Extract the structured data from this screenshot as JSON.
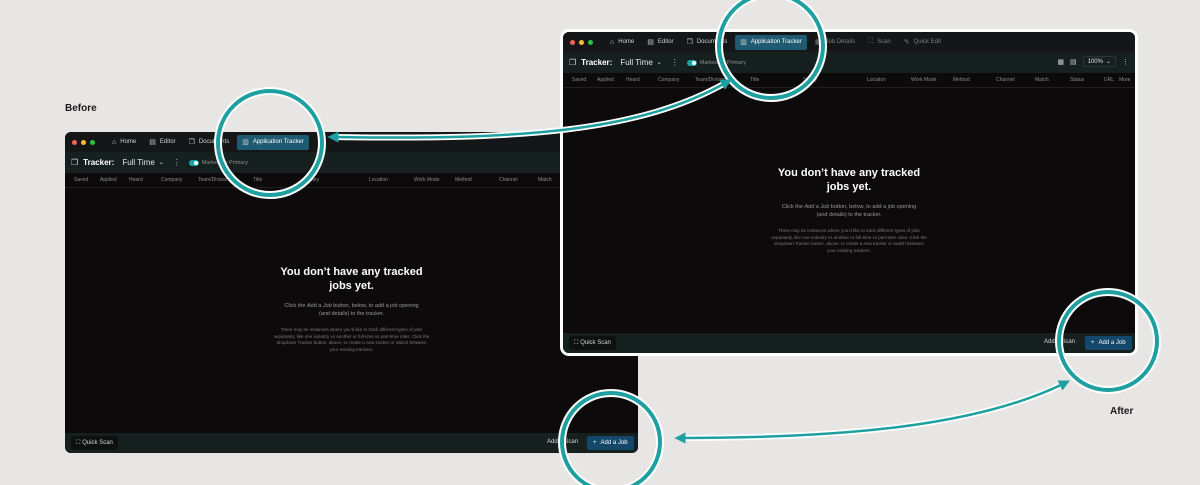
{
  "captions": {
    "before": "Before",
    "after": "After"
  },
  "accent_color": "#1e9fa0",
  "before_window": {
    "tabs": [
      {
        "icon": "home-icon",
        "glyph": "⌂",
        "label": "Home"
      },
      {
        "icon": "editor-icon",
        "glyph": "▤",
        "label": "Editor"
      },
      {
        "icon": "documents-icon",
        "glyph": "❐",
        "label": "Documents"
      },
      {
        "icon": "tracker-icon",
        "glyph": "▥",
        "label": "Application Tracker",
        "active": true
      }
    ],
    "toolbar": {
      "tracker_label": "Tracker:",
      "mode": "Full Time",
      "toggle_label": "Marked as Primary"
    },
    "columns": [
      "Saved",
      "Applied",
      "Heard",
      "Company",
      "Team/Division",
      "Title",
      "Salary",
      "Location",
      "Work Mode",
      "Method",
      "Channel",
      "Match"
    ],
    "empty": {
      "title": "You don’t have any tracked jobs yet.",
      "sub_pre": "Click the ",
      "sub_em": "Add a Job",
      "sub_post": " button, below, to add a job opening (and details) to the tracker.",
      "note": "There may be instances where you’d like to track different types of jobs separately, like one industry vs another or full-time vs part-time roles. Click the dropdown Tracker button, above, to create a new tracker or switch between your existing trackers."
    },
    "bottom": {
      "quick_scan": "Quick Scan",
      "add_scan": "Add a Scan",
      "add_job": "Add a Job"
    }
  },
  "after_window": {
    "tabs": [
      {
        "icon": "home-icon",
        "glyph": "⌂",
        "label": "Home"
      },
      {
        "icon": "editor-icon",
        "glyph": "▤",
        "label": "Editor"
      },
      {
        "icon": "documents-icon",
        "glyph": "❐",
        "label": "Documents"
      },
      {
        "icon": "tracker-icon",
        "glyph": "▥",
        "label": "Application Tracker",
        "active": true
      },
      {
        "icon": "job-details-icon",
        "glyph": "▦",
        "label": "Job Details",
        "dim": true
      },
      {
        "icon": "scan-icon",
        "glyph": "⛶",
        "label": "Scan",
        "dim": true
      },
      {
        "icon": "quick-edit-icon",
        "glyph": "✎",
        "label": "Quick Edit",
        "dim": true
      }
    ],
    "toolbar": {
      "tracker_label": "Tracker:",
      "mode": "Full Time",
      "toggle_label": "Marked as Primary",
      "zoom": "100%"
    },
    "columns": [
      "Saved",
      "Applied",
      "Heard",
      "Company",
      "Team/Division",
      "Title",
      "Salary",
      "Location",
      "Work Mode",
      "Method",
      "Channel",
      "Match",
      "Status",
      "URL",
      "More"
    ],
    "empty": {
      "title": "You don’t have any tracked jobs yet.",
      "sub_pre": "Click the ",
      "sub_em": "Add a Job",
      "sub_post": " button, below, to add a job opening (and details) to the tracker.",
      "note": "There may be instances where you’d like to track different types of jobs separately, like one industry vs another or full-time vs part-time roles. Click the dropdown Tracker button, above, to create a new tracker or switch between your existing trackers."
    },
    "bottom": {
      "quick_scan": "Quick Scan",
      "add_scan": "Add a Scan",
      "add_job": "Add a Job"
    }
  }
}
